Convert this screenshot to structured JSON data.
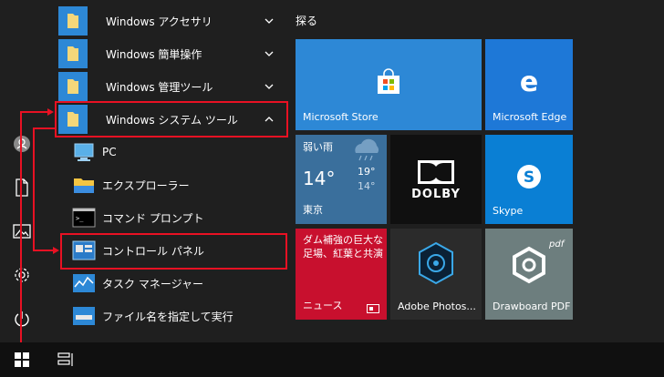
{
  "rail": {
    "items": [
      "user-icon",
      "document-icon",
      "pictures-icon",
      "settings-icon",
      "power-icon"
    ]
  },
  "applist": {
    "items": [
      {
        "label": "Windows アクセサリ",
        "type": "folder",
        "expanded": false
      },
      {
        "label": "Windows 簡単操作",
        "type": "folder",
        "expanded": false
      },
      {
        "label": "Windows 管理ツール",
        "type": "folder",
        "expanded": false
      },
      {
        "label": "Windows システム ツール",
        "type": "folder",
        "expanded": true
      },
      {
        "label": "PC",
        "type": "app"
      },
      {
        "label": "エクスプローラー",
        "type": "app"
      },
      {
        "label": "コマンド プロンプト",
        "type": "app"
      },
      {
        "label": "コントロール パネル",
        "type": "app"
      },
      {
        "label": "タスク マネージャー",
        "type": "app"
      },
      {
        "label": "ファイル名を指定して実行",
        "type": "app"
      }
    ]
  },
  "tiles": {
    "header": "探る",
    "store": {
      "label": "Microsoft Store",
      "color": "#2d88d6"
    },
    "edge": {
      "label": "Microsoft Edge",
      "color": "#1e78d7"
    },
    "weather": {
      "condition": "弱い雨",
      "temp_current": "14°",
      "temp_high": "19°",
      "temp_low": "14°",
      "city": "東京",
      "color": "#3a6f9c"
    },
    "dolby": {
      "logo_text": "DOLBY",
      "color": "#101010"
    },
    "skype": {
      "label": "Skype",
      "color": "#0a7fd4"
    },
    "news": {
      "headline": "ダム補強の巨大な足場、紅葉と共演",
      "label": "ニュース",
      "color": "#c8102e"
    },
    "adobe": {
      "label": "Adobe Photos...",
      "color": "#2b2b2b"
    },
    "drawboard": {
      "label": "Drawboard PDF",
      "logo_text": "pdf",
      "color": "#6d7e7e"
    }
  },
  "taskbar": {
    "items": [
      "windows-start-icon",
      "task-view-icon"
    ]
  },
  "colors": {
    "highlight": "#e81123",
    "background": "#1f1f1f",
    "taskbar": "#101010"
  }
}
